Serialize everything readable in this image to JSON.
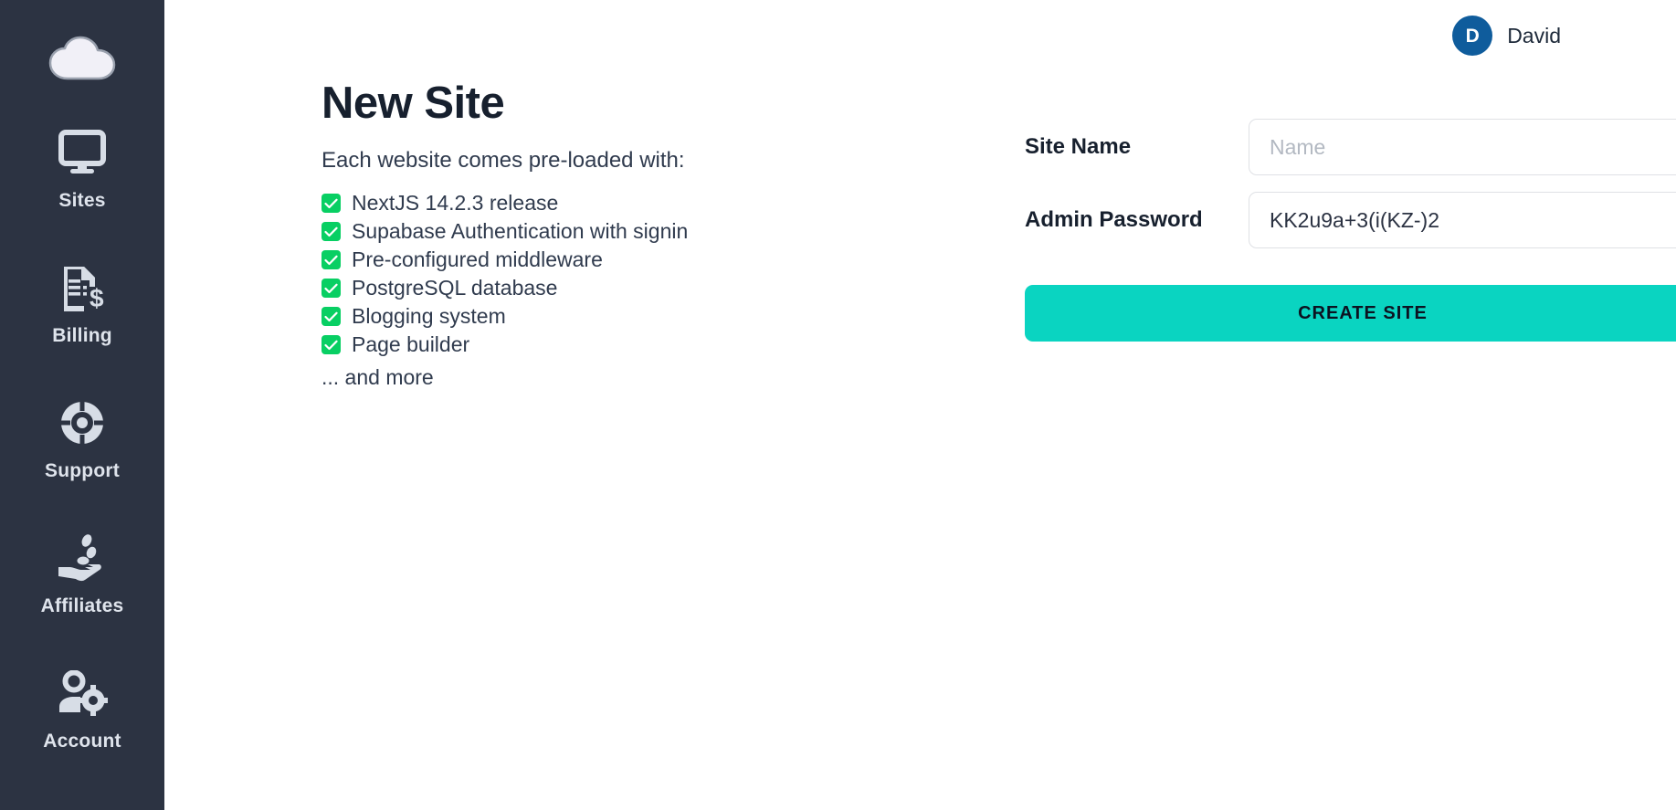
{
  "brand": {
    "logo_icon": "cloud-icon",
    "sidebar_bg": "#2c3342",
    "accent_teal": "#0ad4c1",
    "accent_green": "#08cf63",
    "avatar_blue": "#0f5c9c"
  },
  "sidebar": {
    "items": [
      {
        "label": "Sites",
        "icon": "monitor-icon"
      },
      {
        "label": "Billing",
        "icon": "invoice-dollar-icon"
      },
      {
        "label": "Support",
        "icon": "lifebuoy-icon"
      },
      {
        "label": "Affiliates",
        "icon": "hand-coins-icon"
      },
      {
        "label": "Account",
        "icon": "user-gear-icon"
      }
    ]
  },
  "topbar": {
    "avatar_initial": "D",
    "user_name": "David"
  },
  "page": {
    "title": "New Site",
    "subtitle": "Each website comes pre-loaded with:",
    "features": [
      "NextJS 14.2.3 release",
      "Supabase Authentication with signin",
      "Pre-configured middleware",
      "PostgreSQL database",
      "Blogging system",
      "Page builder"
    ],
    "and_more": "... and more"
  },
  "form": {
    "site_name_label": "Site Name",
    "site_name_value": "",
    "site_name_placeholder": "Name",
    "admin_password_label": "Admin Password",
    "admin_password_value": "KK2u9a+3(i(KZ-)2",
    "admin_password_placeholder": "",
    "create_button_label": "CREATE SITE"
  }
}
